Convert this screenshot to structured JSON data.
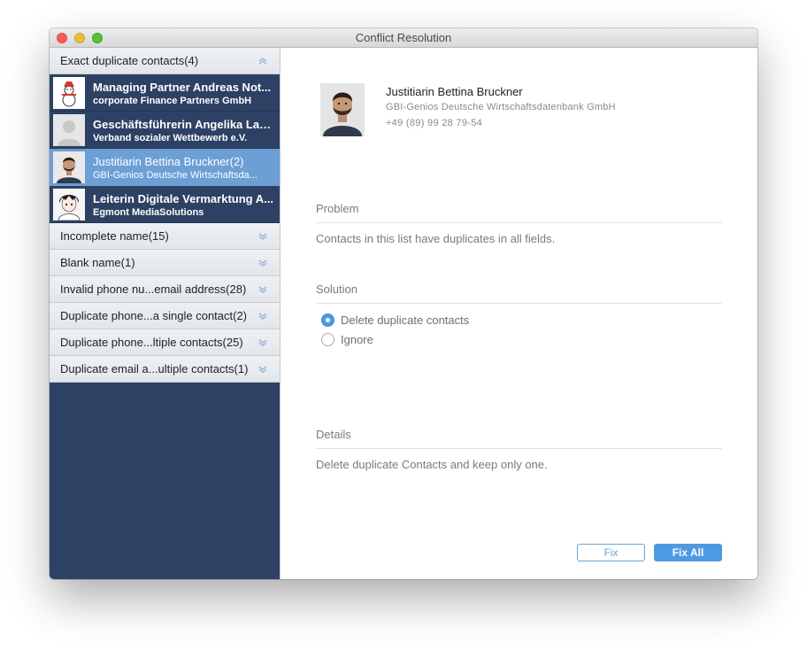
{
  "window": {
    "title": "Conflict Resolution"
  },
  "sidebar": {
    "first_group": {
      "label": "Exact duplicate contacts(4)",
      "chevron": "chevron-up-double-icon"
    },
    "contacts": [
      {
        "name": "Managing Partner Andreas Not...",
        "org": "corporate Finance Partners GmbH",
        "avatar": "snowman-avatar"
      },
      {
        "name": "Geschäftsführerin Angelika Lan...",
        "org": "Verband sozialer Wettbewerb e.V.",
        "avatar": "placeholder-avatar"
      },
      {
        "name": "Justitiarin Bettina Bruckner(2)",
        "org": "GBI-Genios Deutsche Wirtschaftsda...",
        "avatar": "man-photo-avatar"
      },
      {
        "name": "Leiterin Digitale Vermarktung A...",
        "org": "Egmont MediaSolutions",
        "avatar": "anime-avatar"
      }
    ],
    "groups": [
      {
        "label": "Incomplete name(15)"
      },
      {
        "label": "Blank name(1)"
      },
      {
        "label": "Invalid phone nu...email address(28)"
      },
      {
        "label": "Duplicate phone...a single contact(2)"
      },
      {
        "label": "Duplicate phone...ltiple contacts(25)"
      },
      {
        "label": "Duplicate email a...ultiple contacts(1)"
      }
    ]
  },
  "detail": {
    "name": "Justitiarin Bettina Bruckner",
    "org": "GBI-Genios Deutsche Wirtschaftsdatenbank GmbH",
    "phone": "+49 (89) 99 28 79-54"
  },
  "problem": {
    "title": "Problem",
    "text": "Contacts in this list have duplicates in all fields."
  },
  "solution": {
    "title": "Solution",
    "options": [
      {
        "label": "Delete duplicate contacts",
        "selected": true
      },
      {
        "label": "Ignore",
        "selected": false
      }
    ]
  },
  "details": {
    "title": "Details",
    "text": "Delete duplicate Contacts and keep only one."
  },
  "buttons": {
    "fix": "Fix",
    "fix_all": "Fix All"
  },
  "colors": {
    "sidebar_bg": "#2d4164",
    "selected_row": "#6c9fd5",
    "accent": "#4e9ae2"
  }
}
